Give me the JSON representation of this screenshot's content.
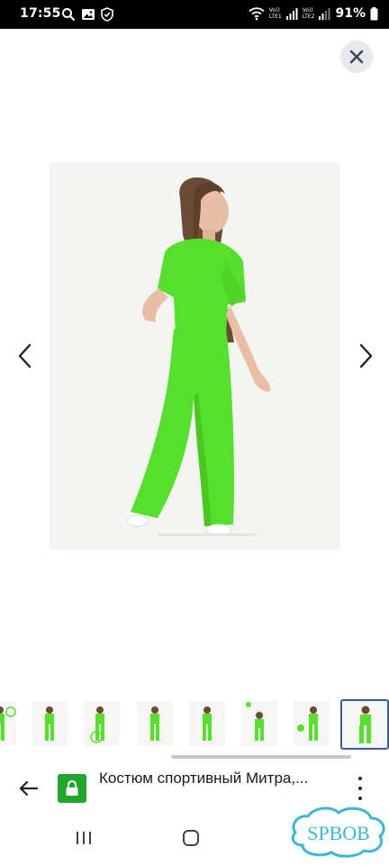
{
  "status_bar": {
    "time": "17:55",
    "sim1": "Vo))\nLTE1",
    "sim2": "Vo))\nLTE2",
    "battery_percent": "91%"
  },
  "product": {
    "page_title": "Костюм спортивный Митра,...",
    "garment_color": "#55e02b",
    "thumbnail_count": 8,
    "active_thumbnail_index": 7
  },
  "watermark": {
    "text": "SPBOB"
  },
  "colors": {
    "accent_green": "#1fa82b",
    "active_thumb_border": "#3f5b97",
    "watermark": "#3ab8d6"
  },
  "icons": {
    "close": "close-icon",
    "prev": "chevron-left-icon",
    "next": "chevron-right-icon",
    "back": "arrow-left-icon",
    "lock": "lock-icon",
    "menu": "more-vertical-icon",
    "recents": "recents-icon",
    "home": "home-icon",
    "back_nav": "back-nav-icon"
  }
}
